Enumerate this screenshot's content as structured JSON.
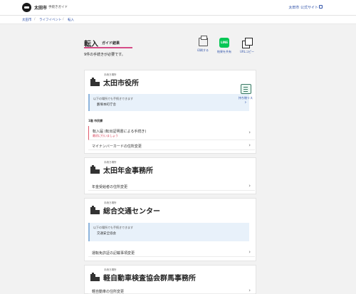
{
  "header": {
    "city": "太田市",
    "guide": "手続きガイド",
    "official_link": "太田市 公式サイト"
  },
  "breadcrumb": [
    "太田市",
    "ライフイベント",
    "転入"
  ],
  "page": {
    "title": "転入",
    "subtitle": "ガイド結果",
    "count_text": "9件の手続きが必要です。"
  },
  "actions": {
    "print": "印刷する",
    "share": "結果を共有",
    "copy": "URLコピー",
    "line_text": "LINE"
  },
  "checklist_label": "持ち物リスト",
  "offices": [
    {
      "eyebrow": "手続き場所",
      "name": "太田市役所",
      "notice_intro": "以下の場所でも手続きできます",
      "notice_place": "藪塚本町庁舎",
      "floor": "1階 市民課",
      "items": [
        {
          "label": "転入届 (転出証明書による手続き)",
          "note": "最初に行いましょう"
        },
        {
          "label": "マイナンバーカードの住所変更"
        }
      ]
    },
    {
      "eyebrow": "手続き場所",
      "name": "太田年金事務所",
      "items": [
        {
          "label": "年金受給者の住所変更"
        }
      ]
    },
    {
      "eyebrow": "手続き場所",
      "name": "総合交通センター",
      "notice_intro": "以下の場所でも手続きできます",
      "notice_place": "交通安全協会",
      "items": [
        {
          "label": "運転免許証の記載事項変更"
        }
      ]
    },
    {
      "eyebrow": "手続き場所",
      "name": "軽自動車検査協会群馬事務所",
      "items": [
        {
          "label": "軽自動車の住所変更"
        }
      ]
    }
  ],
  "colors": {
    "accent": "#d64b87",
    "link": "#3355aa",
    "line_green": "#06c755",
    "notice_bg": "#e8f1fa"
  }
}
